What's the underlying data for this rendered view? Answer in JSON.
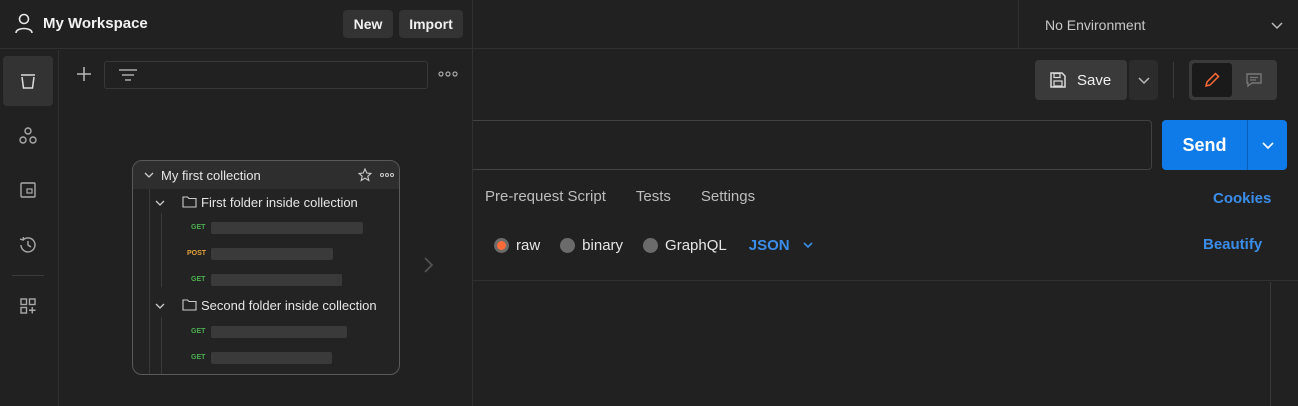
{
  "workspace": {
    "name": "My Workspace",
    "new_label": "New",
    "import_label": "Import"
  },
  "rail": {
    "items": [
      "collections-icon",
      "apis-icon",
      "environments-icon",
      "history-icon",
      "configure-workspace-icon"
    ],
    "active": "collections-icon"
  },
  "environment": {
    "selected": "No Environment"
  },
  "toolbar": {
    "save_label": "Save"
  },
  "request": {
    "url": "",
    "send_label": "Send"
  },
  "tabs": {
    "items": [
      "Pre-request Script",
      "Tests",
      "Settings"
    ],
    "cookies_label": "Cookies"
  },
  "body_options": {
    "raw": "raw",
    "binary": "binary",
    "graphql": "GraphQL",
    "language": "JSON",
    "beautify_label": "Beautify",
    "selected": "raw"
  },
  "collection_preview": {
    "collection_name": "My first collection",
    "folders": [
      {
        "name": "First folder inside collection",
        "requests": [
          "GET",
          "POST",
          "GET"
        ]
      },
      {
        "name": "Second folder inside collection",
        "requests": [
          "GET",
          "GET"
        ]
      }
    ]
  },
  "colors": {
    "accent_blue": "#0f7be8",
    "link_blue": "#3a8eea",
    "orange": "#ff6c37",
    "get_green": "#4caf50",
    "post_orange": "#e6a23c"
  }
}
